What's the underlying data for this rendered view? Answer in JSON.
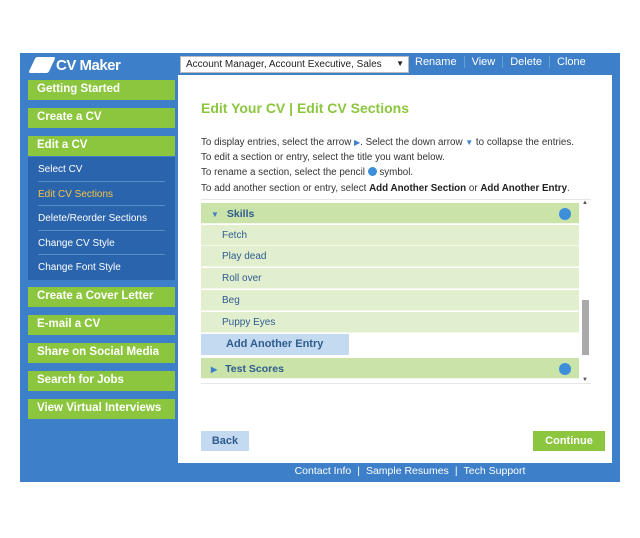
{
  "app": {
    "name": "CV Maker"
  },
  "header": {
    "cv_select": "Account Manager, Account Executive, Sales",
    "links": [
      "Rename",
      "View",
      "Delete",
      "Clone"
    ]
  },
  "sidebar": {
    "top": [
      "Getting Started",
      "Create a CV",
      "Edit a CV"
    ],
    "sub": [
      "Select CV",
      "Edit CV Sections",
      "Delete/Reorder Sections",
      "Change CV Style",
      "Change Font Style"
    ],
    "active_sub": "Edit CV Sections",
    "bottom": [
      "Create a Cover Letter",
      "E-mail a CV",
      "Share on Social Media",
      "Search for Jobs",
      "View Virtual Interviews"
    ]
  },
  "main": {
    "title": "Edit Your CV | Edit CV Sections",
    "instr": {
      "l1a": "To display entries, select the arrow ",
      "l1b": ". Select the down arrow ",
      "l1c": " to collapse the entries.",
      "l2": "To edit a section or entry, select the title you want below.",
      "l3a": "To rename a section, select the pencil ",
      "l3b": " symbol.",
      "l4a": "To add another section or entry, select ",
      "l4b": "Add Another Section",
      "l4c": " or ",
      "l4d": "Add Another Entry",
      "l4e": "."
    },
    "sections": [
      {
        "name": "Skills",
        "expanded": true,
        "entries": [
          "Fetch",
          "Play dead",
          "Roll over",
          "Beg",
          "Puppy Eyes"
        ]
      },
      {
        "name": "Test Scores",
        "expanded": false
      }
    ],
    "add_entry": "Add Another Entry",
    "back": "Back",
    "continue": "Continue"
  },
  "footer": {
    "links": [
      "Contact Info",
      "Sample Resumes",
      "Tech Support"
    ],
    "sep": "|"
  },
  "colors": {
    "frame": "#3d7fc9",
    "green": "#8cc63f",
    "active": "#f7c342"
  }
}
